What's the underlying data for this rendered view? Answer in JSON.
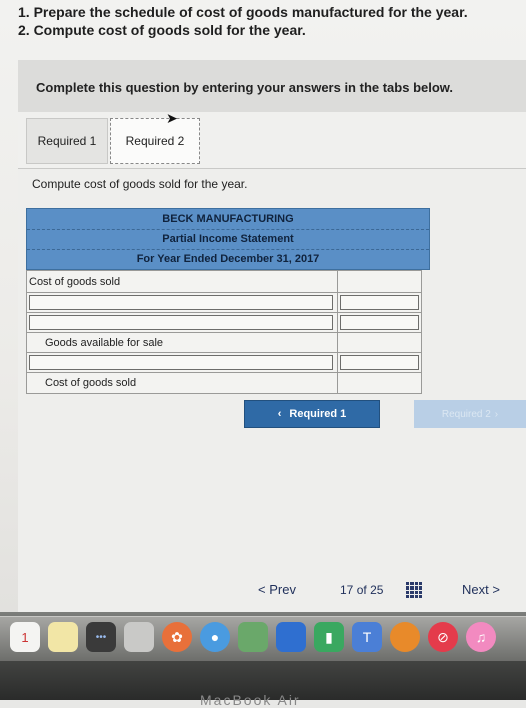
{
  "instructions": {
    "line1": "1. Prepare the schedule of cost of goods manufactured for the year.",
    "line2": "2. Compute cost of goods sold for the year."
  },
  "banner": "Complete this question by entering your answers in the tabs below.",
  "tabs": [
    {
      "label": "Required 1",
      "active": false
    },
    {
      "label": "Required 2",
      "active": true
    }
  ],
  "prompt": "Compute cost of goods sold for the year.",
  "statement": {
    "company": "BECK MANUFACTURING",
    "title": "Partial Income Statement",
    "period": "For Year Ended December 31, 2017"
  },
  "table_rows": [
    {
      "label": "Cost of goods sold",
      "value": ""
    },
    {
      "label": "",
      "value": ""
    },
    {
      "label": "",
      "value": ""
    },
    {
      "label": "Goods available for sale",
      "value": ""
    },
    {
      "label": "",
      "value": ""
    },
    {
      "label": "Cost of goods sold",
      "value": ""
    }
  ],
  "buttons": {
    "prev_tab": "Required 1",
    "next_tab": "Required 2"
  },
  "pagination": {
    "prev": "Prev",
    "current": "17",
    "of": "of",
    "total": "25",
    "next": "Next"
  },
  "dock_label": "MacBook Air",
  "calendar_day": "1",
  "colors": {
    "header_blue": "#5a8fc6",
    "button_blue": "#2f6aa6"
  }
}
